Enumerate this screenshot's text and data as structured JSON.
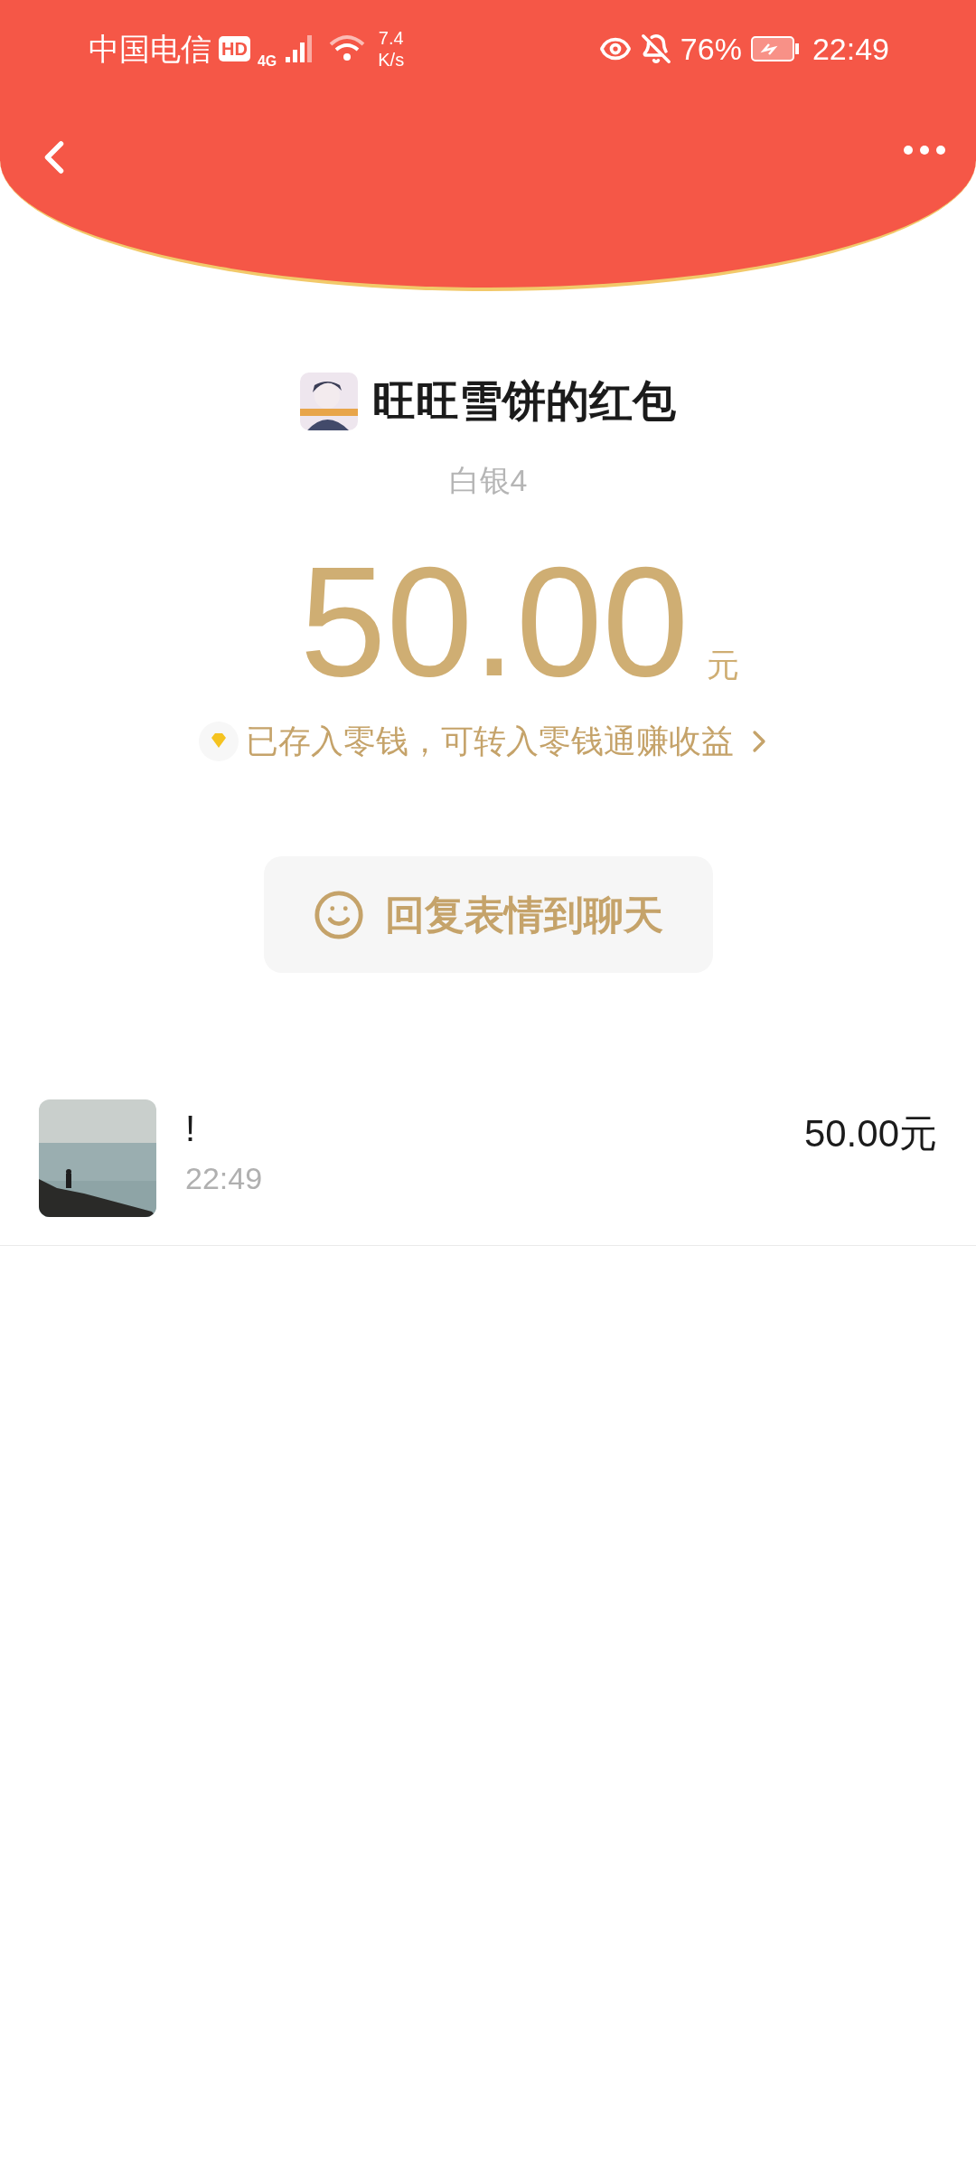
{
  "status_bar": {
    "carrier": "中国电信",
    "hd_badge": "HD",
    "network_type": "4G",
    "speed_value": "7.4",
    "speed_unit": "K/s",
    "battery": "76%",
    "time": "22:49"
  },
  "packet": {
    "title": "旺旺雪饼的红包",
    "level": "白银4",
    "amount": "50.00",
    "unit": "元",
    "notice": "已存入零钱，可转入零钱通赚收益",
    "reply_button": "回复表情到聊天"
  },
  "records": [
    {
      "message": "!",
      "time": "22:49",
      "amount": "50.00元"
    }
  ]
}
